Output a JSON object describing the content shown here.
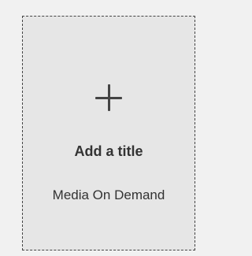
{
  "card": {
    "title": "Add a title",
    "subtitle": "Media On Demand",
    "icon": "plus-icon",
    "border_color": "#444444",
    "background_color": "#e6e6e6"
  }
}
